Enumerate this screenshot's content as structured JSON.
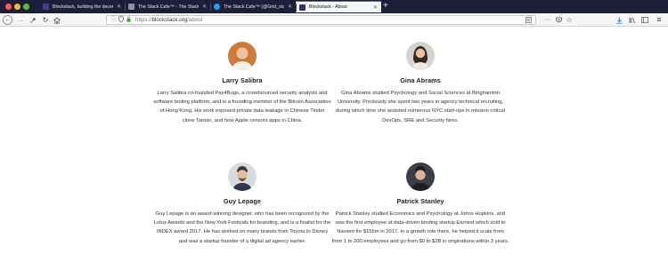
{
  "browser": {
    "tabs": [
      {
        "title": "Blockstack, building the decen",
        "favicon_color": "#4b3b86"
      },
      {
        "title": "The Stack Cafe™ - The Stack",
        "favicon_color": "#8b8fa8"
      },
      {
        "title": "The Stack Cafe™ (@Grid_stack",
        "favicon_color": "#1da1f2"
      },
      {
        "title": "Blockstack - About",
        "favicon_color": "#3b2b6f",
        "active": true
      }
    ],
    "url_scheme": "https://",
    "url_host": "blockstack.org",
    "url_path": "/about",
    "reader_icon": "reader-view-icon",
    "menu_dots": "···"
  },
  "team": [
    {
      "name": "Larry Salibra",
      "bio": "Larry Salibra co-founded Pay4Bugs, a crowdsourced security analysis and software testing platform, and is a founding member of the Bitcoin Association of Hong Kong. His work exposed private data leakage in Chinese Tinder clone Tantan, and how Apple censors apps in China.",
      "avatar_bg": "#d07a3a"
    },
    {
      "name": "Gina Abrams",
      "bio": "Gina Abrams studied Psychology and Social Sciences at Binghamton University. Previously she spent two years in agency technical recruiting, during which time she assisted numerous NYC start-ups in mission critical DevOps, SRE and Security hires.",
      "avatar_bg": "#cfd6cc"
    },
    {
      "name": "Guy Lepage",
      "bio": "Guy Lepage is an award-winning designer, who has been recognized by the Lotus Awards and the New York Festivals for branding, and is a finalist for the INDEX award 2017. He has worked on many brands from Toyota to Disney and was a startup founder of a digital ad agency earlier.",
      "avatar_bg": "#d8dce0"
    },
    {
      "name": "Patrick Stanley",
      "bio": "Patrick Stanley studied Economics and Psychology at Johns Hopkins, and was the first employee at data-driven lending startup Earnest which sold to Navient for $155m in 2017. In a growth role there, he helped it scale from from 1 to 200 employees and go from $0 to $2B in originations within 3 years.",
      "avatar_bg": "#3a3f47"
    }
  ]
}
